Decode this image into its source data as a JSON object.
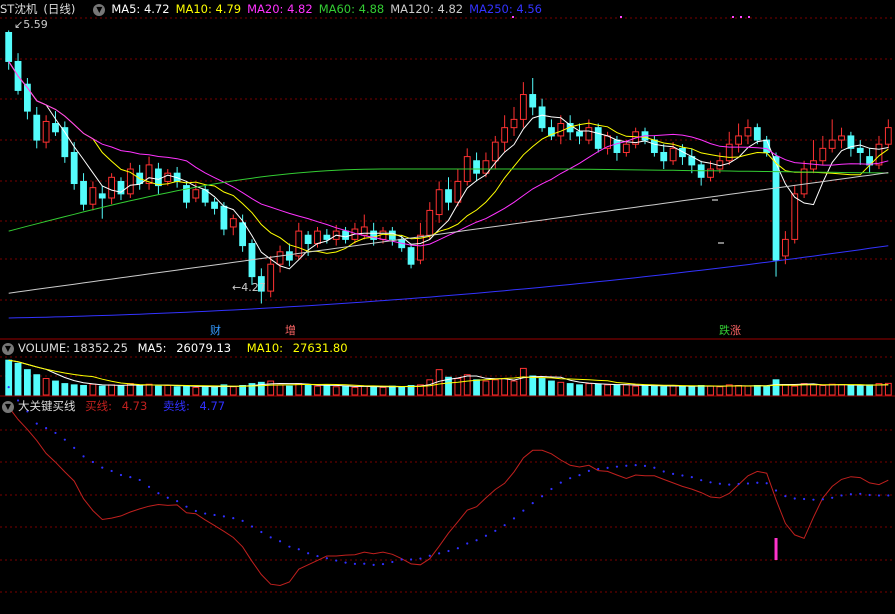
{
  "price_panel": {
    "stock": "ST沈机",
    "period": "(日线)",
    "ma": [
      {
        "label": "MA5:",
        "value": "4.72",
        "color": "#ffffff"
      },
      {
        "label": "MA10:",
        "value": "4.79",
        "color": "#ffff00"
      },
      {
        "label": "MA20:",
        "value": "4.82",
        "color": "#ff33ff"
      },
      {
        "label": "MA60:",
        "value": "4.88",
        "color": "#33cc33"
      },
      {
        "label": "MA120:",
        "value": "4.82",
        "color": "#cccccc"
      },
      {
        "label": "MA250:",
        "value": "4.56",
        "color": "#3333ff"
      }
    ],
    "high_label": "5.59",
    "low_label": "4.27"
  },
  "event_tags": [
    {
      "text": "财",
      "color": "#3399ff"
    },
    {
      "text": "增",
      "color": "#ff6666"
    },
    {
      "text": "跌",
      "color": "#33cc33"
    },
    {
      "text": "涨",
      "color": "#ff6666"
    }
  ],
  "volume_panel": {
    "title": "VOLUME:",
    "value": "18352.25",
    "ma5_label": "MA5:",
    "ma5_value": "26079.13",
    "ma10_label": "MA10:",
    "ma10_value": "27631.80"
  },
  "indicator_panel": {
    "title": "大关键买线",
    "buy_label": "买线:",
    "buy_value": "4.73",
    "sell_label": "卖线:",
    "sell_value": "4.77"
  },
  "colors": {
    "up": "#ff3232",
    "down": "#54fcfc",
    "grid": "#7a0000",
    "buy_line": "#c0201e",
    "sell_dots": "#3030ff",
    "signal": "#ff33cc"
  },
  "chart_data": {
    "type": "candlestick",
    "price_range": [
      4.2,
      5.65
    ],
    "candles": [
      [
        5.58,
        5.44,
        5.59,
        5.4
      ],
      [
        5.44,
        5.3,
        5.48,
        5.28
      ],
      [
        5.33,
        5.2,
        5.36,
        5.16
      ],
      [
        5.18,
        5.06,
        5.22,
        5.02
      ],
      [
        5.05,
        5.15,
        5.18,
        5.02
      ],
      [
        5.14,
        5.1,
        5.2,
        5.08
      ],
      [
        5.12,
        4.98,
        5.15,
        4.95
      ],
      [
        5.0,
        4.85,
        5.05,
        4.82
      ],
      [
        4.86,
        4.75,
        4.9,
        4.72
      ],
      [
        4.75,
        4.83,
        4.86,
        4.72
      ],
      [
        4.8,
        4.78,
        4.84,
        4.68
      ],
      [
        4.78,
        4.88,
        4.9,
        4.75
      ],
      [
        4.86,
        4.8,
        4.88,
        4.77
      ],
      [
        4.8,
        4.92,
        4.95,
        4.78
      ],
      [
        4.9,
        4.85,
        4.94,
        4.82
      ],
      [
        4.85,
        4.94,
        4.98,
        4.82
      ],
      [
        4.92,
        4.84,
        4.95,
        4.8
      ],
      [
        4.86,
        4.9,
        4.92,
        4.84
      ],
      [
        4.9,
        4.86,
        4.93,
        4.83
      ],
      [
        4.84,
        4.76,
        4.86,
        4.73
      ],
      [
        4.78,
        4.82,
        4.85,
        4.76
      ],
      [
        4.82,
        4.76,
        4.84,
        4.74
      ],
      [
        4.76,
        4.73,
        4.78,
        4.7
      ],
      [
        4.74,
        4.63,
        4.76,
        4.6
      ],
      [
        4.64,
        4.68,
        4.7,
        4.6
      ],
      [
        4.66,
        4.55,
        4.7,
        4.52
      ],
      [
        4.56,
        4.4,
        4.58,
        4.36
      ],
      [
        4.4,
        4.33,
        4.44,
        4.27
      ],
      [
        4.33,
        4.46,
        4.5,
        4.3
      ],
      [
        4.46,
        4.52,
        4.55,
        4.42
      ],
      [
        4.52,
        4.48,
        4.56,
        4.45
      ],
      [
        4.5,
        4.62,
        4.66,
        4.48
      ],
      [
        4.6,
        4.56,
        4.62,
        4.5
      ],
      [
        4.56,
        4.62,
        4.64,
        4.54
      ],
      [
        4.6,
        4.58,
        4.63,
        4.56
      ],
      [
        4.58,
        4.62,
        4.65,
        4.55
      ],
      [
        4.62,
        4.58,
        4.64,
        4.56
      ],
      [
        4.58,
        4.63,
        4.66,
        4.56
      ],
      [
        4.6,
        4.64,
        4.7,
        4.58
      ],
      [
        4.62,
        4.58,
        4.66,
        4.55
      ],
      [
        4.58,
        4.62,
        4.64,
        4.56
      ],
      [
        4.62,
        4.58,
        4.64,
        4.55
      ],
      [
        4.58,
        4.54,
        4.6,
        4.52
      ],
      [
        4.54,
        4.46,
        4.56,
        4.44
      ],
      [
        4.48,
        4.6,
        4.66,
        4.46
      ],
      [
        4.6,
        4.72,
        4.76,
        4.58
      ],
      [
        4.7,
        4.82,
        4.86,
        4.66
      ],
      [
        4.82,
        4.76,
        4.88,
        4.72
      ],
      [
        4.76,
        4.86,
        4.92,
        4.74
      ],
      [
        4.86,
        4.98,
        5.02,
        4.84
      ],
      [
        4.96,
        4.9,
        5.0,
        4.86
      ],
      [
        4.9,
        4.96,
        5.0,
        4.88
      ],
      [
        4.96,
        5.05,
        5.08,
        4.92
      ],
      [
        5.05,
        5.12,
        5.18,
        5.0
      ],
      [
        5.12,
        5.16,
        5.22,
        5.08
      ],
      [
        5.16,
        5.28,
        5.34,
        5.12
      ],
      [
        5.28,
        5.22,
        5.36,
        5.18
      ],
      [
        5.22,
        5.12,
        5.26,
        5.1
      ],
      [
        5.12,
        5.08,
        5.16,
        5.06
      ],
      [
        5.08,
        5.14,
        5.18,
        5.04
      ],
      [
        5.14,
        5.1,
        5.18,
        5.06
      ],
      [
        5.1,
        5.08,
        5.14,
        5.04
      ],
      [
        5.06,
        5.12,
        5.16,
        5.04
      ],
      [
        5.12,
        5.02,
        5.14,
        5.0
      ],
      [
        5.02,
        5.08,
        5.1,
        4.99
      ],
      [
        5.06,
        5.0,
        5.08,
        4.96
      ],
      [
        5.0,
        5.04,
        5.06,
        4.98
      ],
      [
        5.04,
        5.1,
        5.12,
        5.02
      ],
      [
        5.1,
        5.06,
        5.12,
        5.04
      ],
      [
        5.06,
        5.0,
        5.08,
        4.98
      ],
      [
        5.0,
        4.96,
        5.04,
        4.92
      ],
      [
        4.96,
        5.02,
        5.05,
        4.94
      ],
      [
        5.02,
        4.98,
        5.04,
        4.94
      ],
      [
        4.98,
        4.94,
        5.02,
        4.9
      ],
      [
        4.94,
        4.88,
        4.96,
        4.84
      ],
      [
        4.88,
        4.92,
        4.96,
        4.86
      ],
      [
        4.92,
        4.96,
        5.0,
        4.9
      ],
      [
        4.96,
        5.04,
        5.1,
        4.94
      ],
      [
        5.04,
        5.08,
        5.14,
        5.0
      ],
      [
        5.08,
        5.12,
        5.16,
        5.04
      ],
      [
        5.12,
        5.06,
        5.14,
        5.04
      ],
      [
        5.06,
        5.0,
        5.08,
        4.98
      ],
      [
        4.98,
        4.48,
        5.0,
        4.4
      ],
      [
        4.5,
        4.58,
        4.62,
        4.46
      ],
      [
        4.58,
        4.8,
        4.84,
        4.56
      ],
      [
        4.8,
        4.92,
        4.96,
        4.78
      ],
      [
        4.92,
        4.96,
        5.06,
        4.9
      ],
      [
        4.96,
        5.02,
        5.08,
        4.94
      ],
      [
        5.02,
        5.06,
        5.16,
        5.0
      ],
      [
        5.06,
        5.08,
        5.12,
        5.02
      ],
      [
        5.08,
        5.02,
        5.1,
        4.98
      ],
      [
        5.02,
        5.0,
        5.06,
        4.94
      ],
      [
        4.98,
        4.94,
        5.02,
        4.9
      ],
      [
        4.94,
        5.04,
        5.08,
        4.92
      ],
      [
        5.04,
        5.12,
        5.16,
        5.02
      ]
    ],
    "volumes": [
      55000,
      50000,
      40000,
      32000,
      26000,
      22000,
      18000,
      16000,
      15000,
      17000,
      14000,
      16000,
      14000,
      18000,
      15000,
      17000,
      14000,
      15000,
      13000,
      14000,
      12000,
      14000,
      12000,
      16000,
      13000,
      15000,
      18000,
      20000,
      22000,
      16000,
      14000,
      18000,
      16000,
      14000,
      15000,
      13000,
      14000,
      12000,
      14000,
      13000,
      12000,
      14000,
      13000,
      15000,
      16000,
      24000,
      40000,
      28000,
      26000,
      32000,
      24000,
      22000,
      24000,
      26000,
      22000,
      42000,
      30000,
      26000,
      22000,
      20000,
      18000,
      16000,
      18000,
      17000,
      16000,
      15000,
      16000,
      14000,
      15000,
      14000,
      13000,
      15000,
      14000,
      13000,
      15000,
      14000,
      13000,
      16000,
      15000,
      14000,
      15000,
      14000,
      24000,
      16000,
      14000,
      18000,
      16000,
      15000,
      17000,
      16000,
      15000,
      14000,
      16000,
      18000,
      18352
    ]
  }
}
